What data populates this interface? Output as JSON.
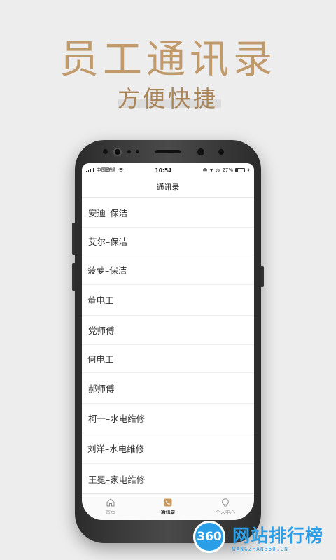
{
  "promo": {
    "headline": "员工通讯录",
    "subheadline": "方便快捷"
  },
  "statusbar": {
    "carrier": "中国联通",
    "time": "10:54",
    "battery_text": "27%",
    "battery_level": 0.27
  },
  "navbar": {
    "title": "通讯录"
  },
  "contacts": [
    "安迪–保洁",
    "艾尔–保洁",
    "菠萝–保洁",
    "董电工",
    "党师傅",
    "何电工",
    "郝师傅",
    "柯一–水电维修",
    "刘洋–水电维修",
    "王冕–家电维修"
  ],
  "tabbar": {
    "tabs": [
      {
        "label": "首页",
        "icon": "home-icon",
        "active": false
      },
      {
        "label": "通讯录",
        "icon": "phone-book-icon",
        "active": true
      },
      {
        "label": "个人中心",
        "icon": "user-icon",
        "active": false
      }
    ]
  },
  "colors": {
    "gold": "#c09a6a",
    "watermark_blue": "#2a9fe8",
    "active_tab_icon": "#c99a5b"
  },
  "watermark": {
    "badge": "360",
    "name": "网站排行榜",
    "url": "WANGZHAN360.CN"
  }
}
